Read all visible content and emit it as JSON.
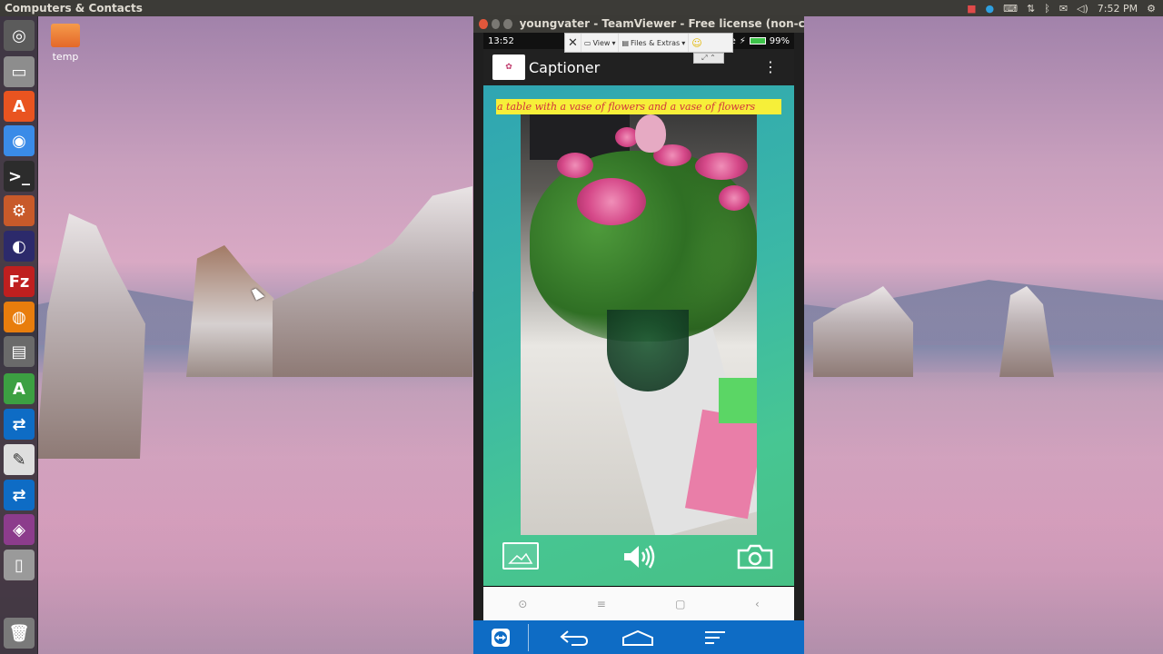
{
  "top_panel": {
    "title": "Computers & Contacts",
    "clock": "7:52 PM"
  },
  "desktop": {
    "icons": [
      {
        "label": "temp",
        "icon": "folder-icon"
      }
    ]
  },
  "launcher": {
    "items": [
      {
        "name": "ubuntu-dash-icon",
        "glyph": "◎",
        "color": "#5b5b5b"
      },
      {
        "name": "files-icon",
        "glyph": "▭",
        "color": "#8d8d8d"
      },
      {
        "name": "software-center-icon",
        "glyph": "A",
        "color": "#e95420"
      },
      {
        "name": "chrome-icon",
        "glyph": "◉",
        "color": "#3a8be8"
      },
      {
        "name": "terminal-icon",
        "glyph": ">_",
        "color": "#2c2c2c"
      },
      {
        "name": "system-settings-icon",
        "glyph": "⚙",
        "color": "#c85a2a"
      },
      {
        "name": "eclipse-icon",
        "glyph": "◐",
        "color": "#2c2a6b"
      },
      {
        "name": "filezilla-icon",
        "glyph": "Fz",
        "color": "#bf1f1f"
      },
      {
        "name": "blender-icon",
        "glyph": "◍",
        "color": "#e87d0d"
      },
      {
        "name": "drive-icon",
        "glyph": "▤",
        "color": "#6a6a6a"
      },
      {
        "name": "android-studio-icon",
        "glyph": "A",
        "color": "#3ca042"
      },
      {
        "name": "teamviewer-icon",
        "glyph": "⇄",
        "color": "#0e6cc5"
      },
      {
        "name": "text-editor-icon",
        "glyph": "✎",
        "color": "#dedede"
      },
      {
        "name": "teamviewer-2-icon",
        "glyph": "⇄",
        "color": "#0e6cc5"
      },
      {
        "name": "media-icon",
        "glyph": "◈",
        "color": "#8c3c8c"
      },
      {
        "name": "device-icon",
        "glyph": "▯",
        "color": "#9a9a9a"
      },
      {
        "name": "trash-icon",
        "glyph": "🗑",
        "color": "#7a7a7a"
      }
    ]
  },
  "teamviewer": {
    "window_title": "youngvater - TeamViewer - Free license (non-commer",
    "toolbar": {
      "close": "✕",
      "view": "View",
      "files_extras": "Files & Extras"
    }
  },
  "phone": {
    "status_time": "13:52",
    "carrier": "de",
    "battery": "99%",
    "app": {
      "title": "Captioner",
      "logo_text": "✿",
      "caption": "a table with a vase of flowers and a vase of flowers"
    },
    "nav": {
      "recent": "▢",
      "back": "‹",
      "home": "▢",
      "menu": "≡",
      "dot": "⊙"
    }
  },
  "tv_bottom": {
    "items": [
      "teamviewer-logo-icon",
      "back-arrow-icon",
      "home-icon",
      "menu-icon"
    ]
  }
}
